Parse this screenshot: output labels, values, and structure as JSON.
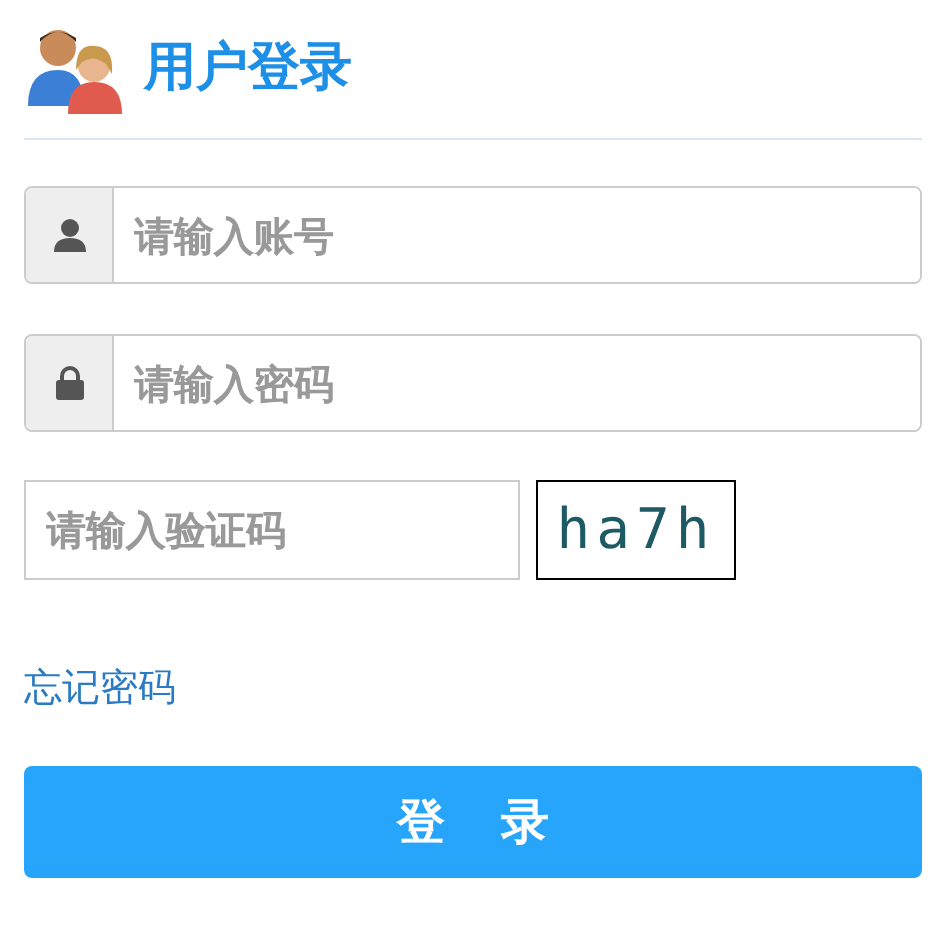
{
  "title": "用户登录",
  "fields": [
    {
      "kind": "account",
      "placeholder": "请输入账号"
    },
    {
      "kind": "password",
      "placeholder": "请输入密码"
    }
  ],
  "captcha": {
    "placeholder": "请输入验证码",
    "code": "ha7h"
  },
  "forgot_link": "忘记密码",
  "login_button": "登 录"
}
